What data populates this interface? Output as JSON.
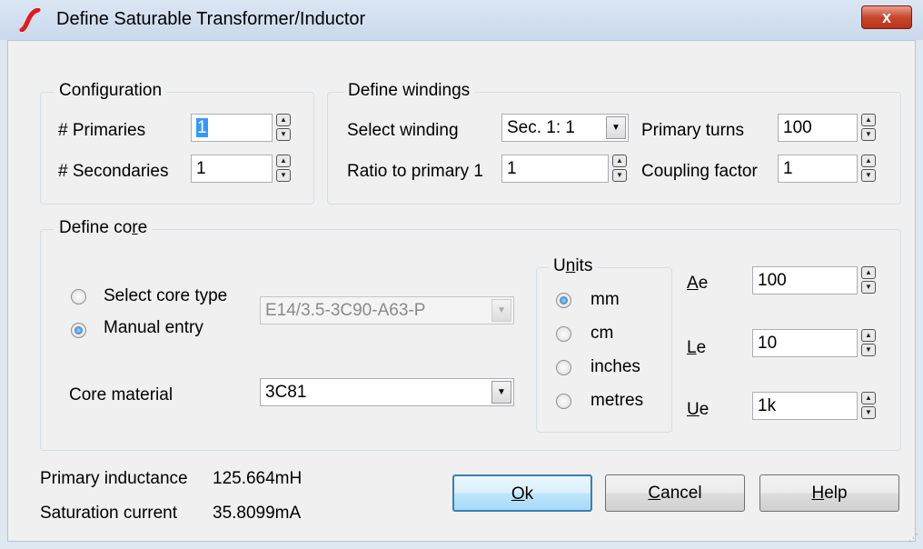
{
  "window": {
    "title": "Define Saturable Transformer/Inductor",
    "close_label": "x"
  },
  "configuration": {
    "legend": "Configuration",
    "primaries_label": "# Primaries",
    "primaries_value": "1",
    "secondaries_label": "# Secondaries",
    "secondaries_value": "1"
  },
  "windings": {
    "legend": "Define windings",
    "select_winding_label": "Select winding",
    "select_winding_value": "Sec. 1: 1",
    "ratio_label": "Ratio to primary 1",
    "ratio_value": "1",
    "primary_turns_label": "Primary turns",
    "primary_turns_value": "100",
    "coupling_label": "Coupling factor",
    "coupling_value": "1"
  },
  "core": {
    "legend_pre": "Define co",
    "legend_key": "r",
    "legend_post": "e",
    "select_core_type_label": "Select core type",
    "manual_entry_label": "Manual entry",
    "core_type_value": "E14/3.5-3C90-A63-P",
    "core_material_label": "Core material",
    "core_material_value": "3C81",
    "mode": "manual"
  },
  "units": {
    "legend_pre": "U",
    "legend_key": "n",
    "legend_post": "its",
    "options": [
      "mm",
      "cm",
      "inches",
      "metres"
    ],
    "selected": "mm"
  },
  "params": {
    "ae_key": "A",
    "ae_rest": "e",
    "ae_value": "100",
    "le_key": "L",
    "le_rest": "e",
    "le_value": "10",
    "ue_key": "U",
    "ue_rest": "e",
    "ue_value": "1k"
  },
  "results": {
    "inductance_label": "Primary inductance",
    "inductance_value": "125.664mH",
    "saturation_label": "Saturation current",
    "saturation_value": "35.8099mA"
  },
  "buttons": {
    "ok_key": "O",
    "ok_rest": "k",
    "cancel_key": "C",
    "cancel_rest": "ancel",
    "help_key": "H",
    "help_rest": "elp"
  },
  "icons": {
    "app": "simetrix-logo-icon",
    "close": "close-icon",
    "spin": "spin-up-down-icon",
    "dropdown": "chevron-down-icon",
    "grip": "resize-grip-icon"
  },
  "colors": {
    "accent": "#3399ff",
    "close_button": "#c9462d",
    "default_button_border": "#3c7fb1",
    "app_icon": "#e31b1b"
  }
}
